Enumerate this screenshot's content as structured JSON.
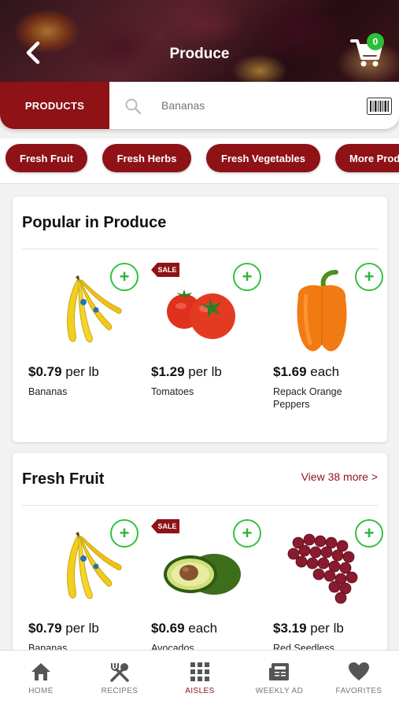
{
  "header": {
    "title": "Produce",
    "cart_count": "0"
  },
  "search": {
    "tab_label": "PRODUCTS",
    "placeholder": "Bananas"
  },
  "categories": [
    "Fresh Fruit",
    "Fresh Herbs",
    "Fresh Vegetables",
    "More Produce"
  ],
  "popular": {
    "title": "Popular in Produce",
    "items": [
      {
        "price": "$0.79",
        "unit": " per lb",
        "name": "Bananas",
        "sale": ""
      },
      {
        "price": "$1.29",
        "unit": " per lb",
        "name": "Tomatoes",
        "sale": "SALE"
      },
      {
        "price": "$1.69",
        "unit": " each",
        "name": "Repack Orange Peppers",
        "sale": ""
      }
    ]
  },
  "fresh_fruit": {
    "title": "Fresh Fruit",
    "view_more": "View 38 more >",
    "items": [
      {
        "price": "$0.79",
        "unit": " per lb",
        "name": "Bananas",
        "sale": ""
      },
      {
        "price": "$0.69",
        "unit": " each",
        "name": "Avocados",
        "sale": "SALE"
      },
      {
        "price": "$3.19",
        "unit": " per lb",
        "name": "Red Seedless",
        "sale": ""
      }
    ]
  },
  "nav": [
    {
      "label": "HOME",
      "icon": "home-icon"
    },
    {
      "label": "RECIPES",
      "icon": "utensils-icon"
    },
    {
      "label": "AISLES",
      "icon": "grid-icon"
    },
    {
      "label": "WEEKLY AD",
      "icon": "newspaper-icon"
    },
    {
      "label": "FAVORITES",
      "icon": "heart-icon"
    }
  ],
  "colors": {
    "brand": "#8e1216",
    "add_green": "#33c13f",
    "badge_green": "#2bbf3a"
  }
}
